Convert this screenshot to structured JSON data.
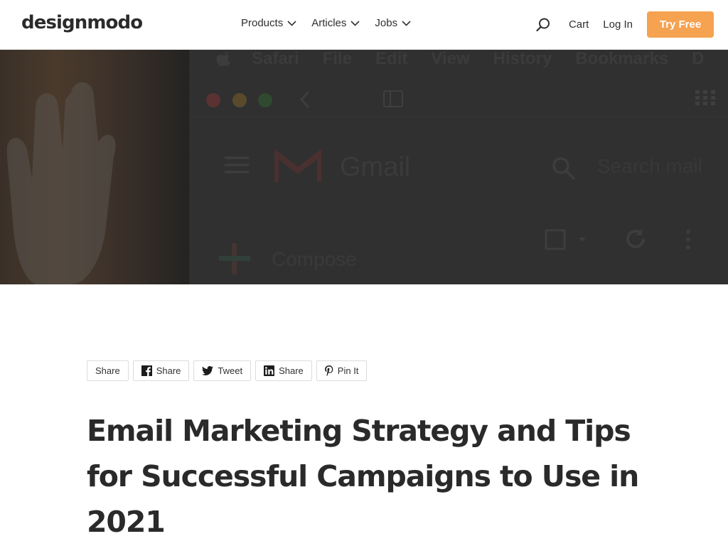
{
  "header": {
    "logo": "designmodo",
    "nav": [
      {
        "label": "Products"
      },
      {
        "label": "Articles"
      },
      {
        "label": "Jobs"
      }
    ],
    "cart_label": "Cart",
    "login_label": "Log In",
    "cta_label": "Try Free",
    "cta_color": "#f5a251"
  },
  "hero": {
    "mac_menu": [
      "Safari",
      "File",
      "Edit",
      "View",
      "History",
      "Bookmarks",
      "D"
    ],
    "app_name": "Gmail",
    "search_placeholder": "Search mail",
    "compose_label": "Compose"
  },
  "share": {
    "buttons": [
      {
        "label": "Share",
        "icon": "none"
      },
      {
        "label": "Share",
        "icon": "facebook-icon"
      },
      {
        "label": "Tweet",
        "icon": "twitter-icon"
      },
      {
        "label": "Share",
        "icon": "linkedin-icon"
      },
      {
        "label": "Pin It",
        "icon": "pinterest-icon"
      }
    ]
  },
  "article": {
    "title": "Email Marketing Strategy and Tips for Successful Campaigns to Use in 2021"
  }
}
